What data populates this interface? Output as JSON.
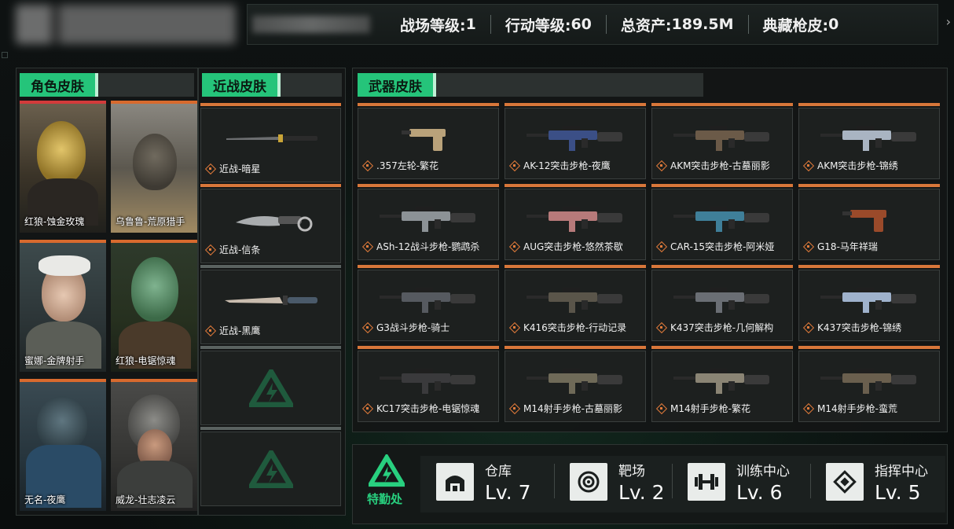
{
  "header": {
    "stats": [
      {
        "label": "战场等级:",
        "value": "1"
      },
      {
        "label": "行动等级: ",
        "value": "60"
      },
      {
        "label": "总资产:",
        "value": "189.5M"
      },
      {
        "label": "典藏枪皮:",
        "value": "0"
      }
    ]
  },
  "panels": {
    "character_title": "角色皮肤",
    "melee_title": "近战皮肤",
    "weapon_title": "武器皮肤"
  },
  "character_skins": [
    {
      "name": "红狼-蚀金玫瑰"
    },
    {
      "name": "乌鲁鲁-荒原猎手"
    },
    {
      "name": "蜜娜-金牌射手"
    },
    {
      "name": "红狼-电锯惊魂"
    },
    {
      "name": "无名-夜鹰"
    },
    {
      "name": "威龙-壮志凌云"
    }
  ],
  "melee_skins": [
    {
      "name": "近战-暗星"
    },
    {
      "name": "近战-信条"
    },
    {
      "name": "近战-黑鹰"
    }
  ],
  "weapon_skins": [
    {
      "name": ".357左轮-繁花"
    },
    {
      "name": "AK-12突击步枪-夜鹰"
    },
    {
      "name": "AKM突击步枪-古墓丽影"
    },
    {
      "name": "AKM突击步枪-锦绣"
    },
    {
      "name": "ASh-12战斗步枪-鹦鹉杀"
    },
    {
      "name": "AUG突击步枪-悠然茶歇"
    },
    {
      "name": "CAR-15突击步枪-阿米娅"
    },
    {
      "name": "G18-马年祥瑞"
    },
    {
      "name": "G3战斗步枪-骑士"
    },
    {
      "name": "K416突击步枪-行动记录"
    },
    {
      "name": "K437突击步枪-几何解构"
    },
    {
      "name": "K437突击步枪-锦绣"
    },
    {
      "name": "KC17突击步枪-电锯惊魂"
    },
    {
      "name": "M14射手步枪-古墓丽影"
    },
    {
      "name": "M14射手步枪-繁花"
    },
    {
      "name": "M14射手步枪-蛮荒"
    }
  ],
  "facilities": {
    "special_ops": "特勤处",
    "items": [
      {
        "name": "仓库",
        "level": "Lv. 7",
        "icon": "warehouse-icon"
      },
      {
        "name": "靶场",
        "level": "Lv. 2",
        "icon": "target-icon"
      },
      {
        "name": "训练中心",
        "level": "Lv. 6",
        "icon": "dumbbell-icon"
      },
      {
        "name": "指挥中心",
        "level": "Lv. 5",
        "icon": "command-icon"
      }
    ]
  },
  "colors": {
    "accent_green": "#25c47a",
    "accent_orange": "#d8773a",
    "accent_red": "#d23b3b"
  }
}
